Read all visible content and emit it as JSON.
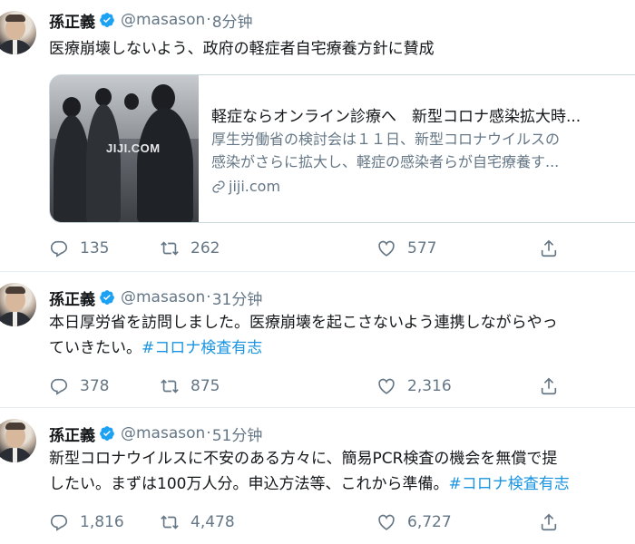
{
  "tweets": [
    {
      "name": "孫正義",
      "handle": "@masason",
      "separator": "·",
      "time": "8分钟",
      "text_lines": [
        "医療崩壊しないよう、政府の軽症者自宅療養方針に賛成"
      ],
      "card": {
        "image_logo": "JIJI.COM",
        "title": "軽症ならオンライン診療へ　新型コロナ感染拡大時...",
        "desc_lines": [
          "厚生労働省の検討会は１１日、新型コロナウイルスの",
          "感染がさらに拡大し、軽症の感染者らが自宅療養す..."
        ],
        "url": "jiji.com"
      },
      "replies": "135",
      "retweets": "262",
      "likes": "577"
    },
    {
      "name": "孫正義",
      "handle": "@masason",
      "separator": "·",
      "time": "31分钟",
      "text_line1": "本日厚労省を訪問しました。医療崩壊を起こさないよう連携しながらやっ",
      "text_line2_plain": "ていきたい。",
      "text_line2_hashtag": "#コロナ検査有志",
      "replies": "378",
      "retweets": "875",
      "likes": "2,316"
    },
    {
      "name": "孫正義",
      "handle": "@masason",
      "separator": "·",
      "time": "51分钟",
      "text_line1": "新型コロナウイルスに不安のある方々に、簡易PCR検査の機会を無償で提",
      "text_line2_plain": "したい。まずは100万人分。申込方法等、これから準備。",
      "text_line2_hashtag": "#コロナ検査有志",
      "replies": "1,816",
      "retweets": "4,478",
      "likes": "6,727"
    }
  ],
  "colors": {
    "accent": "#1b95e0",
    "verified": "#1da1f2",
    "muted": "#657786",
    "divider": "#e6ecf0"
  },
  "icons": [
    "verified-badge-icon",
    "reply-icon",
    "retweet-icon",
    "like-icon",
    "share-icon",
    "link-icon"
  ]
}
